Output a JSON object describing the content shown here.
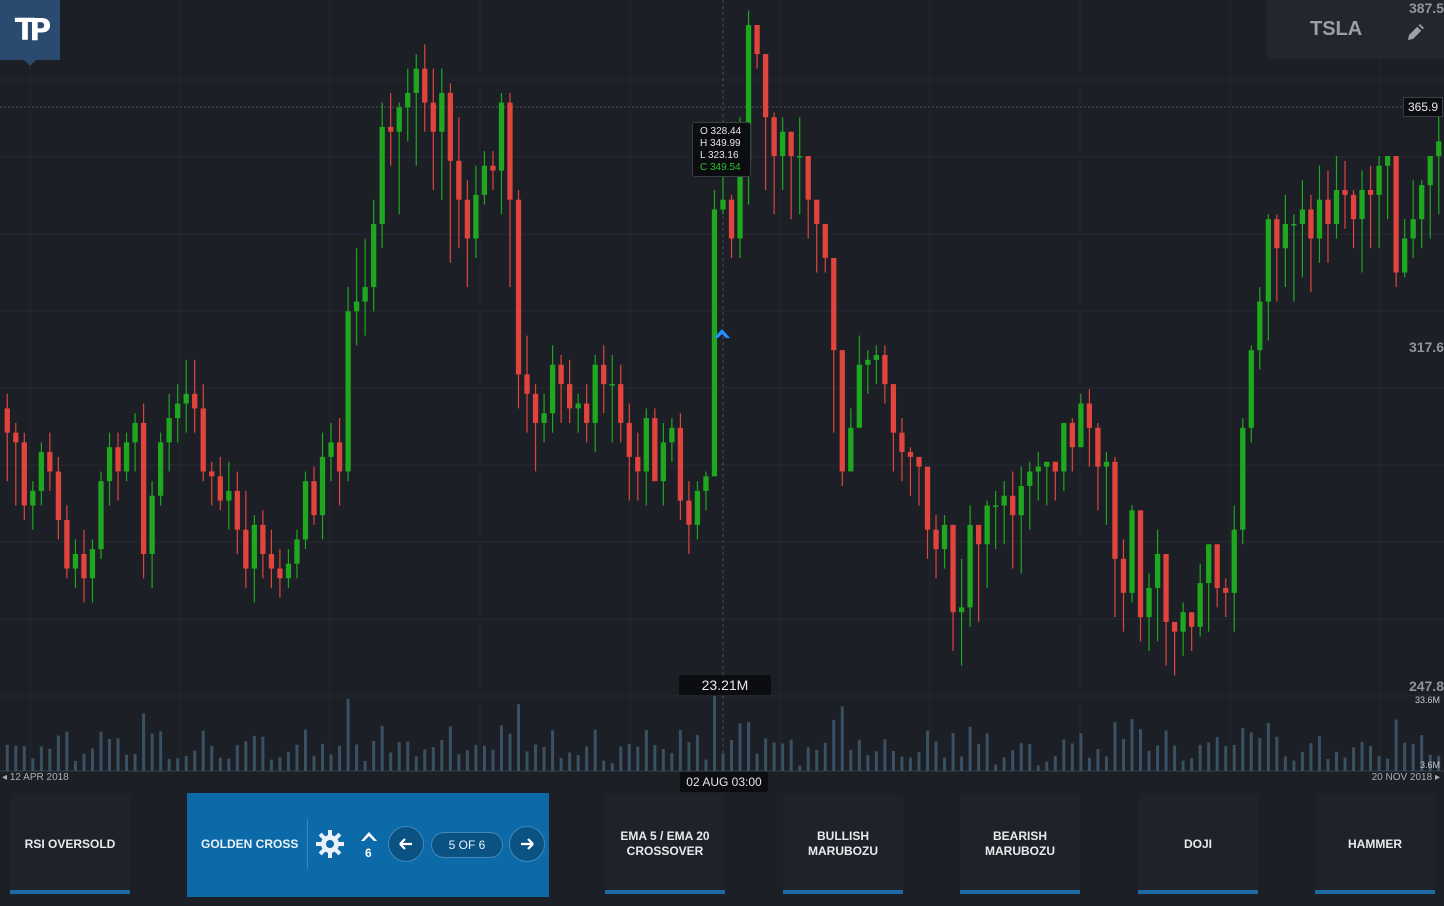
{
  "app": {
    "logo_text": "TP"
  },
  "symbol": {
    "ticker": "TSLA",
    "edit_icon": "pencil-icon"
  },
  "price_axis": {
    "labels": [
      "387.5",
      "317.6",
      "247.8"
    ],
    "current_price": "365.9"
  },
  "volume_axis": {
    "max": "33.6M",
    "min": "3.6M"
  },
  "tooltip": {
    "open": "O 328.44",
    "high": "H 349.99",
    "low": "L 323.16",
    "close": "C 349.54"
  },
  "crosshair": {
    "volume": "23.21M",
    "date": "02 AUG 03:00"
  },
  "date_range": {
    "start": "12 APR 2018",
    "end": "20 NOV 2018"
  },
  "colors": {
    "up": "#1fa81f",
    "down": "#e0443c",
    "accent": "#0c6aa8",
    "marker": "#1e90ff",
    "volume": "#3a5164"
  },
  "patterns": {
    "items": [
      {
        "label": "RSI OVERSOLD"
      },
      {
        "label": "EMA 5 / EMA 20 CROSSOVER"
      },
      {
        "label": "BULLISH MARUBOZU"
      },
      {
        "label": "BEARISH MARUBOZU"
      },
      {
        "label": "DOJI"
      },
      {
        "label": "HAMMER"
      }
    ],
    "active": {
      "label": "GOLDEN CROSS",
      "count": "6",
      "pagination": "5 OF 6",
      "settings_icon": "gear-icon",
      "signal_icon": "chevron-up-icon",
      "prev_icon": "arrow-left-icon",
      "next_icon": "arrow-right-icon"
    }
  },
  "chart_data": {
    "type": "candlestick",
    "symbol": "TSLA",
    "ylim": [
      247.8,
      387.5
    ],
    "x_start": "12 APR 2018",
    "x_end": "20 NOV 2018",
    "candles": [
      [
        305,
        308,
        290,
        300
      ],
      [
        300,
        302,
        285,
        298
      ],
      [
        298,
        300,
        282,
        285
      ],
      [
        285,
        290,
        280,
        288
      ],
      [
        288,
        298,
        285,
        296
      ],
      [
        296,
        300,
        288,
        292
      ],
      [
        292,
        295,
        278,
        282
      ],
      [
        282,
        285,
        270,
        272
      ],
      [
        272,
        278,
        268,
        275
      ],
      [
        275,
        280,
        265,
        270
      ],
      [
        270,
        278,
        265,
        276
      ],
      [
        276,
        292,
        274,
        290
      ],
      [
        290,
        300,
        285,
        297
      ],
      [
        297,
        300,
        286,
        292
      ],
      [
        292,
        300,
        290,
        298
      ],
      [
        298,
        304,
        292,
        302
      ],
      [
        302,
        306,
        270,
        275
      ],
      [
        275,
        290,
        268,
        287
      ],
      [
        287,
        300,
        285,
        298
      ],
      [
        298,
        308,
        292,
        303
      ],
      [
        303,
        310,
        298,
        306
      ],
      [
        306,
        315,
        300,
        308
      ],
      [
        308,
        315,
        300,
        305
      ],
      [
        305,
        310,
        290,
        292
      ],
      [
        292,
        294,
        285,
        291
      ],
      [
        291,
        295,
        284,
        286
      ],
      [
        286,
        294,
        280,
        288
      ],
      [
        288,
        292,
        275,
        280
      ],
      [
        280,
        288,
        268,
        272
      ],
      [
        272,
        283,
        265,
        281
      ],
      [
        281,
        284,
        270,
        275
      ],
      [
        275,
        280,
        268,
        272
      ],
      [
        272,
        276,
        266,
        270
      ],
      [
        270,
        276,
        268,
        273
      ],
      [
        273,
        280,
        270,
        278
      ],
      [
        278,
        292,
        276,
        290
      ],
      [
        290,
        293,
        281,
        283
      ],
      [
        283,
        300,
        278,
        295
      ],
      [
        295,
        302,
        290,
        298
      ],
      [
        298,
        303,
        285,
        292
      ],
      [
        292,
        330,
        290,
        325
      ],
      [
        325,
        338,
        318,
        327
      ],
      [
        327,
        340,
        320,
        330
      ],
      [
        330,
        348,
        325,
        343
      ],
      [
        343,
        368,
        338,
        363
      ],
      [
        363,
        370,
        355,
        362
      ],
      [
        362,
        368,
        345,
        367
      ],
      [
        367,
        375,
        360,
        370
      ],
      [
        370,
        378,
        355,
        375
      ],
      [
        375,
        380,
        362,
        368
      ],
      [
        368,
        375,
        350,
        362
      ],
      [
        362,
        375,
        348,
        370
      ],
      [
        370,
        372,
        335,
        356
      ],
      [
        356,
        365,
        338,
        348
      ],
      [
        348,
        352,
        330,
        340
      ],
      [
        340,
        355,
        336,
        349
      ],
      [
        349,
        358,
        347,
        355
      ],
      [
        355,
        358,
        350,
        354
      ],
      [
        354,
        370,
        345,
        368
      ],
      [
        368,
        370,
        330,
        348
      ],
      [
        348,
        350,
        305,
        312
      ],
      [
        312,
        320,
        300,
        308
      ],
      [
        308,
        310,
        292,
        302
      ],
      [
        302,
        308,
        298,
        304
      ],
      [
        304,
        318,
        300,
        314
      ],
      [
        314,
        316,
        302,
        310
      ],
      [
        310,
        315,
        302,
        305
      ],
      [
        305,
        308,
        300,
        306
      ],
      [
        306,
        310,
        298,
        302
      ],
      [
        302,
        316,
        296,
        314
      ],
      [
        314,
        318,
        304,
        310
      ],
      [
        310,
        316,
        298,
        310
      ],
      [
        310,
        314,
        298,
        302
      ],
      [
        302,
        306,
        286,
        295
      ],
      [
        295,
        300,
        286,
        292
      ],
      [
        292,
        305,
        285,
        303
      ],
      [
        303,
        305,
        290,
        290
      ],
      [
        290,
        302,
        285,
        298
      ],
      [
        298,
        303,
        294,
        301
      ],
      [
        301,
        304,
        282,
        286
      ],
      [
        286,
        290,
        275,
        281
      ],
      [
        281,
        290,
        278,
        288
      ],
      [
        288,
        292,
        284,
        291
      ],
      [
        291,
        350,
        327,
        346
      ],
      [
        346,
        354,
        345,
        348
      ],
      [
        348,
        349,
        336,
        340
      ],
      [
        340,
        365,
        336,
        356
      ],
      [
        356,
        387,
        347,
        384
      ],
      [
        384,
        380,
        375,
        378
      ],
      [
        378,
        372,
        350,
        365
      ],
      [
        365,
        366,
        345,
        357
      ],
      [
        357,
        365,
        350,
        362
      ],
      [
        362,
        360,
        344,
        357
      ],
      [
        357,
        365,
        345,
        357
      ],
      [
        357,
        350,
        340,
        348
      ],
      [
        348,
        345,
        333,
        343
      ],
      [
        343,
        342,
        333,
        336
      ],
      [
        336,
        320,
        300,
        317
      ],
      [
        317,
        304,
        289,
        292
      ],
      [
        292,
        305,
        298,
        301
      ],
      [
        301,
        320,
        307,
        314
      ],
      [
        314,
        317,
        308,
        315
      ],
      [
        315,
        318,
        310,
        316
      ],
      [
        316,
        318,
        306,
        310
      ],
      [
        310,
        310,
        292,
        300
      ],
      [
        300,
        303,
        290,
        296
      ],
      [
        296,
        297,
        287,
        295
      ],
      [
        295,
        294,
        285,
        293
      ],
      [
        293,
        289,
        274,
        280
      ],
      [
        280,
        283,
        270,
        276
      ],
      [
        276,
        283,
        272,
        281
      ],
      [
        281,
        279,
        255,
        263
      ],
      [
        263,
        274,
        252,
        264
      ],
      [
        264,
        285,
        260,
        281
      ],
      [
        281,
        278,
        261,
        277
      ],
      [
        277,
        286,
        268,
        285
      ],
      [
        285,
        288,
        276,
        285
      ],
      [
        285,
        290,
        277,
        287
      ],
      [
        287,
        292,
        272,
        283
      ],
      [
        283,
        293,
        271,
        289
      ],
      [
        289,
        294,
        280,
        292
      ],
      [
        292,
        296,
        286,
        293
      ],
      [
        293,
        293,
        285,
        294
      ],
      [
        294,
        294,
        286,
        292
      ],
      [
        292,
        302,
        288,
        302
      ],
      [
        302,
        303,
        292,
        297
      ],
      [
        297,
        308,
        300,
        306
      ],
      [
        306,
        309,
        293,
        301
      ],
      [
        301,
        302,
        284,
        293
      ],
      [
        293,
        296,
        281,
        294
      ],
      [
        294,
        295,
        262,
        274
      ],
      [
        274,
        278,
        259,
        267
      ],
      [
        267,
        285,
        265,
        284
      ],
      [
        284,
        274,
        257,
        262
      ],
      [
        262,
        271,
        255,
        268
      ],
      [
        268,
        280,
        257,
        275
      ],
      [
        275,
        268,
        252,
        261
      ],
      [
        261,
        261,
        250,
        259
      ],
      [
        259,
        265,
        254,
        263
      ],
      [
        263,
        263,
        255,
        260
      ],
      [
        260,
        273,
        258,
        269
      ],
      [
        269,
        275,
        259,
        277
      ],
      [
        277,
        272,
        264,
        268
      ],
      [
        268,
        270,
        262,
        267
      ],
      [
        267,
        285,
        259,
        280
      ],
      [
        280,
        303,
        277,
        301
      ],
      [
        301,
        318,
        298,
        317
      ],
      [
        317,
        330,
        313,
        327
      ],
      [
        327,
        345,
        319,
        344
      ],
      [
        344,
        345,
        327,
        338
      ],
      [
        338,
        349,
        330,
        343
      ],
      [
        343,
        345,
        327,
        343
      ],
      [
        343,
        352,
        332,
        346
      ],
      [
        346,
        349,
        329,
        340
      ],
      [
        340,
        355,
        335,
        348
      ],
      [
        348,
        354,
        335,
        343
      ],
      [
        343,
        357,
        340,
        350
      ],
      [
        350,
        356,
        342,
        349
      ],
      [
        349,
        350,
        338,
        344
      ],
      [
        344,
        354,
        333,
        350
      ],
      [
        350,
        355,
        338,
        349
      ],
      [
        349,
        357,
        338,
        355
      ],
      [
        355,
        357,
        344,
        357
      ],
      [
        357,
        352,
        330,
        333
      ],
      [
        333,
        344,
        332,
        340
      ],
      [
        340,
        352,
        336,
        344
      ],
      [
        344,
        352,
        338,
        351
      ],
      [
        351,
        354,
        340,
        357
      ],
      [
        357,
        368,
        345,
        360
      ]
    ],
    "volume_max": "33.6M",
    "volume_min": "3.6M",
    "crosshair_volume": "23.21M",
    "crosshair_date": "02 AUG 03:00",
    "marker": "golden-cross signal (up arrow)"
  }
}
